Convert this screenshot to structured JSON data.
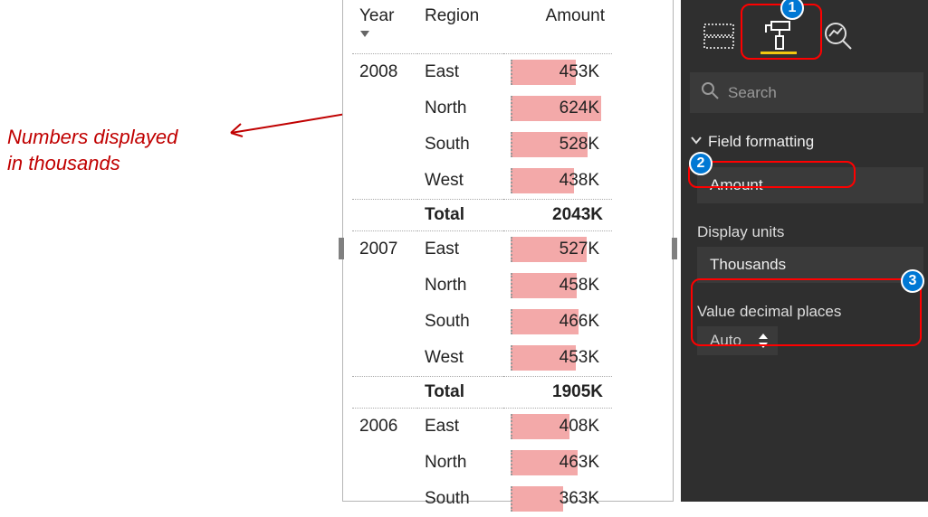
{
  "annotation": {
    "line1": "Numbers displayed",
    "line2": "in thousands"
  },
  "matrix": {
    "columns": {
      "year": "Year",
      "region": "Region",
      "amount": "Amount"
    },
    "groups": [
      {
        "year": "2008",
        "rows": [
          {
            "region": "East",
            "amount": "453K",
            "bar": 72
          },
          {
            "region": "North",
            "amount": "624K",
            "bar": 100
          },
          {
            "region": "South",
            "amount": "528K",
            "bar": 85
          },
          {
            "region": "West",
            "amount": "438K",
            "bar": 70
          }
        ],
        "total_label": "Total",
        "total_amount": "2043K"
      },
      {
        "year": "2007",
        "rows": [
          {
            "region": "East",
            "amount": "527K",
            "bar": 84
          },
          {
            "region": "North",
            "amount": "458K",
            "bar": 73
          },
          {
            "region": "South",
            "amount": "466K",
            "bar": 75
          },
          {
            "region": "West",
            "amount": "453K",
            "bar": 72
          }
        ],
        "total_label": "Total",
        "total_amount": "1905K"
      },
      {
        "year": "2006",
        "rows": [
          {
            "region": "East",
            "amount": "408K",
            "bar": 65
          },
          {
            "region": "North",
            "amount": "463K",
            "bar": 74
          },
          {
            "region": "South",
            "amount": "363K",
            "bar": 58
          }
        ]
      }
    ]
  },
  "pane": {
    "search_placeholder": "Search",
    "section_title": "Field formatting",
    "field": "Amount",
    "display_units_label": "Display units",
    "display_units_value": "Thousands",
    "decimal_places_label": "Value decimal places",
    "decimal_places_value": "Auto"
  },
  "callouts": {
    "n1": "1",
    "n2": "2",
    "n3": "3"
  }
}
